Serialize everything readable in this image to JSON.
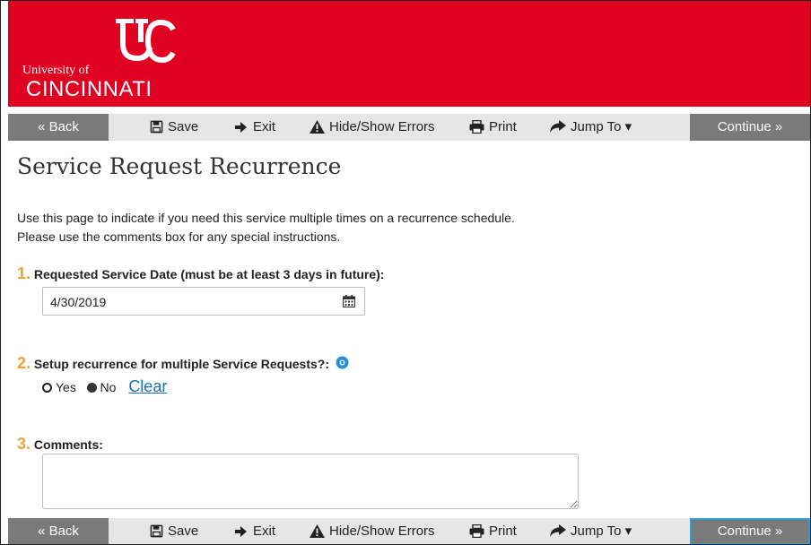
{
  "header": {
    "university_of": "University of",
    "cincinnati": "CINCINNATI",
    "brand_color": "#e00122"
  },
  "toolbar": {
    "back": "« Back",
    "save": "Save",
    "exit": "Exit",
    "hide_show_errors": "Hide/Show Errors",
    "print": "Print",
    "jump_to": "Jump To ▾",
    "continue": "Continue »"
  },
  "page": {
    "title": "Service Request Recurrence",
    "intro_line1": "Use this page to indicate if you need this service multiple times on a recurrence schedule.",
    "intro_line2": "Please use the comments box for any special instructions."
  },
  "questions": {
    "q1_num": "1.",
    "q1_label": "Requested Service Date (must be at least 3 days in future):",
    "q1_value": "4/30/2019",
    "q2_num": "2.",
    "q2_label": "Setup recurrence for multiple Service Requests?:",
    "q2_yes": "Yes",
    "q2_no": "No",
    "q2_selected": "No",
    "q2_clear": "Clear",
    "q3_num": "3.",
    "q3_label": "Comments:",
    "q3_value": ""
  }
}
